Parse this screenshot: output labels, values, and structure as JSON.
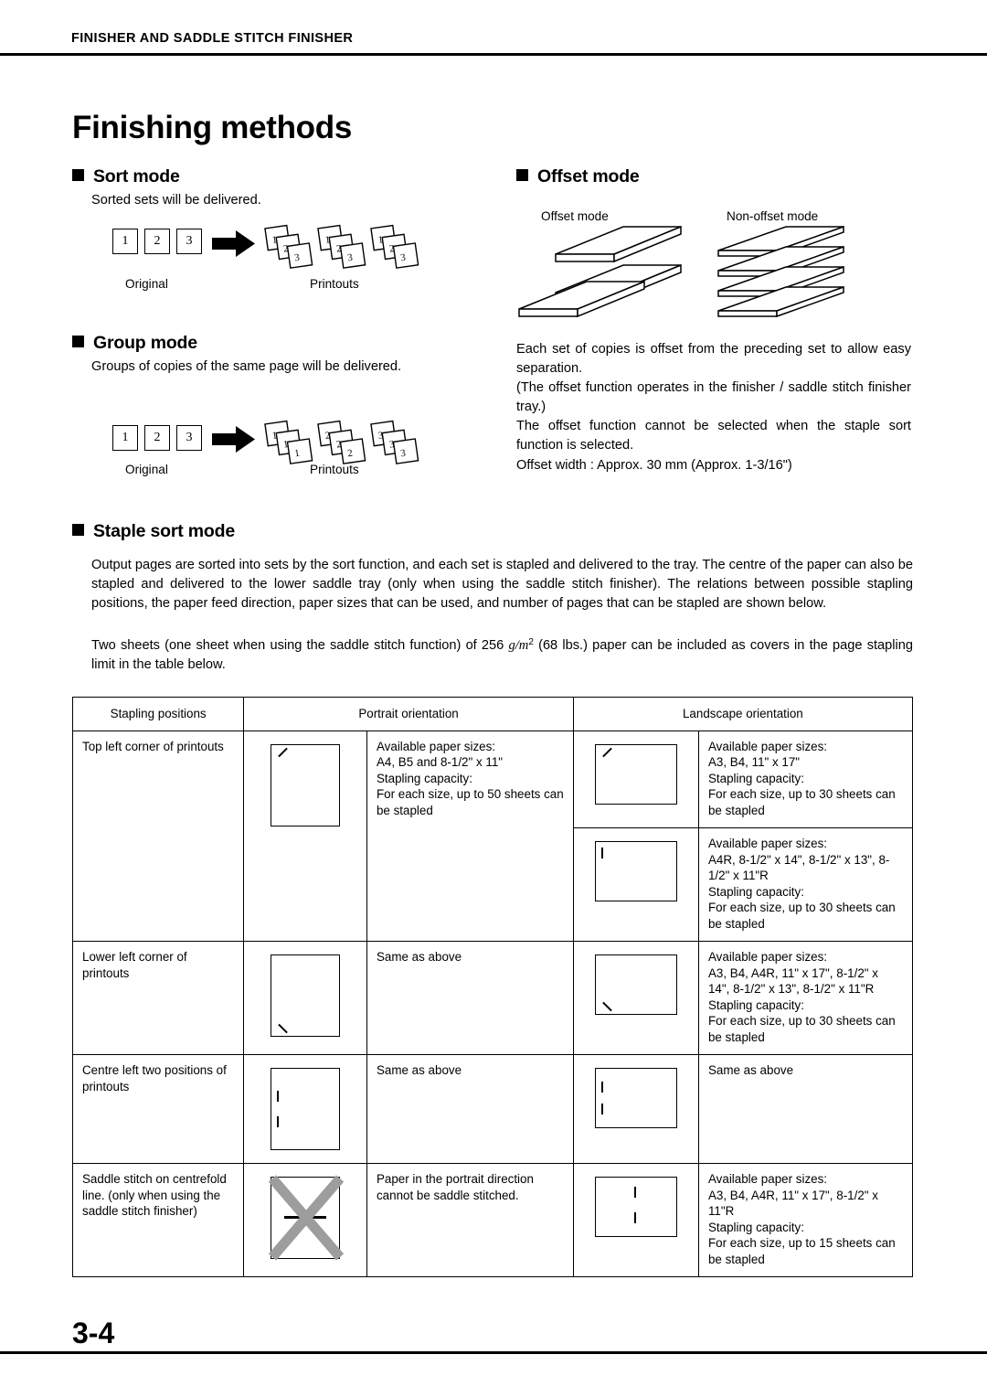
{
  "header": {
    "title": "FINISHER AND SADDLE STITCH FINISHER"
  },
  "page_title": "Finishing methods",
  "page_number": "3-4",
  "sections": {
    "sort": {
      "heading": "Sort mode",
      "text": "Sorted sets will be delivered.",
      "caption_left": "Original",
      "caption_right": "Printouts",
      "original_numbers": [
        "1",
        "2",
        "3"
      ]
    },
    "group": {
      "heading": "Group mode",
      "text": "Groups of copies of the same page will be delivered.",
      "caption_left": "Original",
      "caption_right": "Printouts",
      "original_numbers": [
        "1",
        "2",
        "3"
      ]
    },
    "offset": {
      "heading": "Offset mode",
      "label_left": "Offset mode",
      "label_right": "Non-offset mode",
      "para1": "Each set of copies is offset from the preceding set to allow easy separation.",
      "para2": "(The offset function operates in the finisher / saddle stitch finisher tray.)",
      "para3": "The offset function cannot be selected when the staple sort function is selected.",
      "para4": "Offset width : Approx. 30 mm (Approx. 1-3/16\")"
    },
    "staple": {
      "heading": "Staple sort mode",
      "para1": "Output pages are sorted into sets by the sort function, and each set is stapled and delivered to the tray. The centre of the paper can also be stapled and delivered to the lower saddle tray (only when using the saddle stitch finisher). The relations between possible stapling positions, the paper feed direction, paper sizes that can be used, and number of pages that can be stapled are shown below.",
      "para2_a": "Two sheets (one sheet when using the saddle stitch function) of 256 ",
      "para2_b": "g/m",
      "para2_c": "2",
      "para2_d": " (68 lbs.",
      "para2_e": ") paper can be included as covers in the page stapling limit in the table below."
    }
  },
  "table": {
    "headers": [
      "Stapling positions",
      "Portrait orientation",
      "Landscape orientation"
    ],
    "rows": [
      {
        "position": "Top left corner of printouts",
        "portrait": "Available paper sizes:\nA4, B5 and 8-1/2\" x 11\"\nStapling capacity:\nFor each size, up to 50 sheets can be stapled",
        "landscape": "Available paper sizes:\nA3, B4, 11\" x 17\"\nStapling capacity:\nFor each size, up to 30 sheets can be stapled"
      },
      {
        "position": "",
        "portrait": "",
        "landscape": "Available paper sizes:\nA4R, 8-1/2\" x 14\", 8-1/2\" x 13\", 8-1/2\" x 11\"R\nStapling capacity:\nFor each size, up to 30 sheets can be stapled"
      },
      {
        "position": "Lower left corner of printouts",
        "portrait": "Same as above",
        "landscape": "Available paper sizes:\nA3, B4, A4R, 11\" x 17\", 8-1/2\" x 14\", 8-1/2\" x 13\", 8-1/2\" x 11\"R\nStapling capacity:\nFor each size, up to 30 sheets can be stapled"
      },
      {
        "position": "Centre left two positions of printouts",
        "portrait": "Same as above",
        "landscape": "Same as above"
      },
      {
        "position": "Saddle stitch on centrefold line. (only when using the saddle stitch finisher)",
        "portrait": "Paper in the portrait direction cannot be saddle stitched.",
        "landscape": "Available paper sizes:\nA3, B4, A4R, 11\" x 17\", 8-1/2\" x 11\"R\nStapling capacity:\nFor each size, up to 15 sheets can be stapled"
      }
    ]
  }
}
